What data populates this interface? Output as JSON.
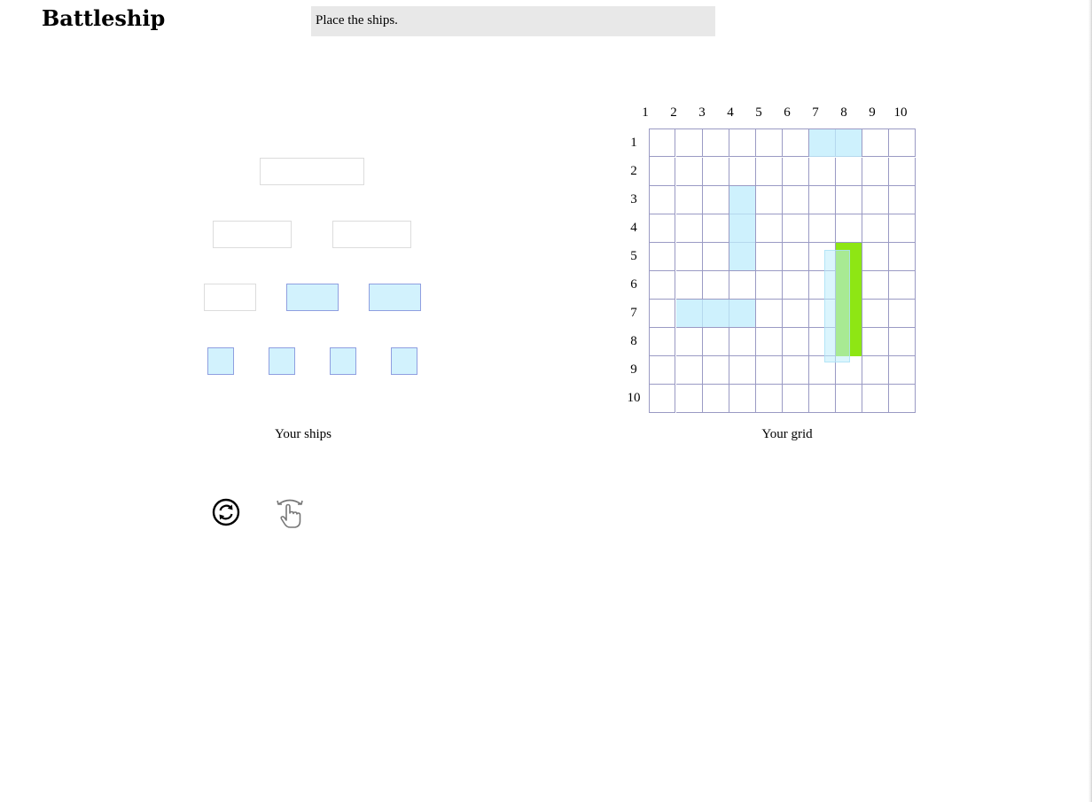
{
  "app": {
    "title": "Battleship",
    "status_message": "Place the ships."
  },
  "ship_dock": {
    "label": "Your ships",
    "rows": [
      {
        "ship_size": 4,
        "slots": [
          "empty"
        ]
      },
      {
        "ship_size": 3,
        "slots": [
          "empty",
          "empty"
        ]
      },
      {
        "ship_size": 2,
        "slots": [
          "empty",
          "ship",
          "ship"
        ]
      },
      {
        "ship_size": 1,
        "slots": [
          "ship",
          "ship",
          "ship",
          "ship"
        ]
      }
    ]
  },
  "grid": {
    "label": "Your grid",
    "columns": [
      "1",
      "2",
      "3",
      "4",
      "5",
      "6",
      "7",
      "8",
      "9",
      "10"
    ],
    "rows": [
      "1",
      "2",
      "3",
      "4",
      "5",
      "6",
      "7",
      "8",
      "9",
      "10"
    ],
    "placed_ships": [
      {
        "row": 1,
        "col": 7,
        "length": 2,
        "orientation": "horizontal"
      },
      {
        "row": 3,
        "col": 4,
        "length": 3,
        "orientation": "vertical"
      },
      {
        "row": 7,
        "col": 2,
        "length": 3,
        "orientation": "horizontal"
      }
    ],
    "drop_target": {
      "row": 5,
      "col": 8,
      "length": 4,
      "orientation": "vertical",
      "color": "#8ee614"
    },
    "dragging_ship": {
      "length": 4,
      "orientation": "vertical"
    }
  },
  "controls": [
    {
      "name": "rotate-ships-icon"
    },
    {
      "name": "drag-gesture-icon"
    }
  ],
  "colors": {
    "ship_fill": "#d2f2fd",
    "ship_border": "#8f9fe0",
    "grid_line": "#9a9ac4",
    "drop_target": "#8ee614",
    "status_bg": "#e8e8e8"
  }
}
